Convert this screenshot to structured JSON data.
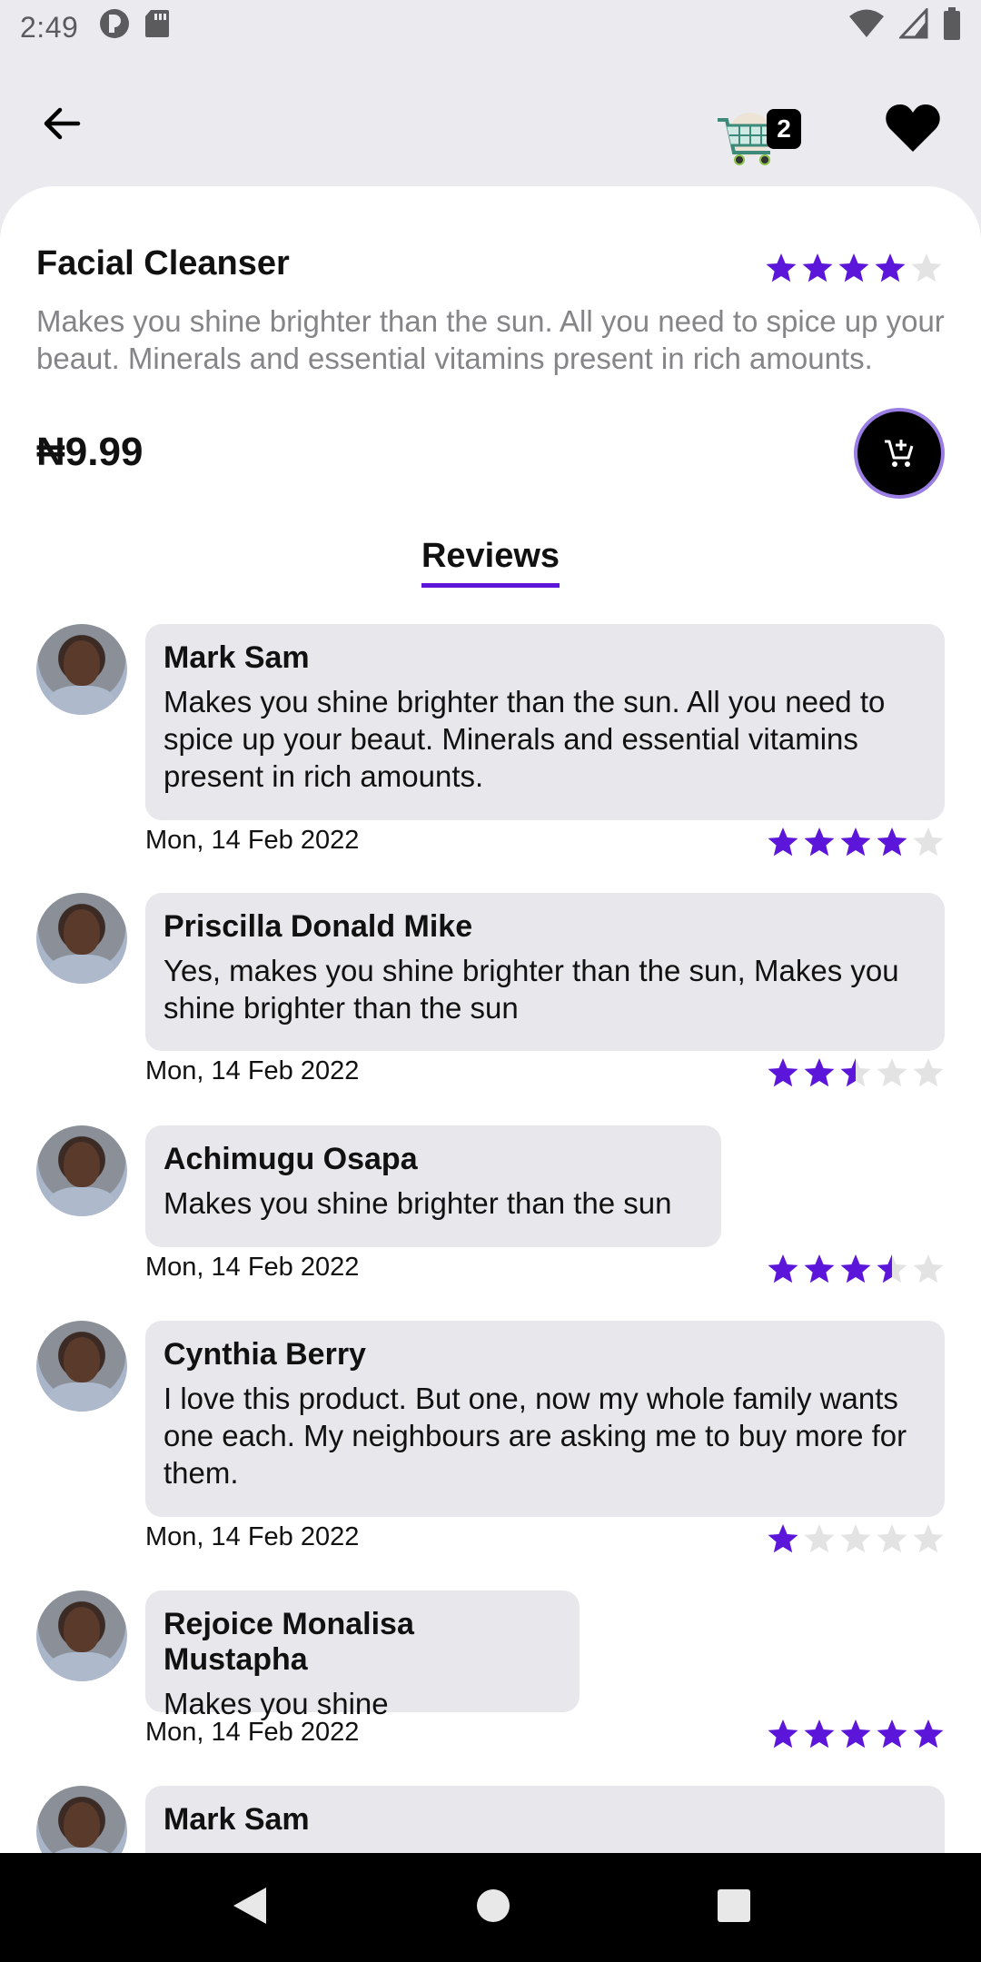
{
  "status": {
    "time": "2:49"
  },
  "header": {
    "cart_count": "2"
  },
  "product": {
    "name": "Facial Cleanser",
    "rating": 4,
    "description": "Makes you shine brighter than the sun. All you need to spice up your beaut. Minerals and essential vitamins present in rich amounts.",
    "price": "₦9.99"
  },
  "reviews_tab": {
    "label": "Reviews"
  },
  "reviews": [
    {
      "name": "Mark Sam",
      "text": "Makes you shine brighter than the sun. All you need to spice up your beaut. Minerals and essential vitamins present in rich amounts.",
      "date": "Mon, 14 Feb 2022",
      "rating": 4
    },
    {
      "name": "Priscilla Donald Mike",
      "text": "Yes, makes you shine brighter than the sun, Makes you shine brighter than the sun",
      "date": "Mon, 14 Feb 2022",
      "rating": 2.5
    },
    {
      "name": "Achimugu Osapa",
      "text": "Makes you shine brighter than the sun",
      "date": "Mon, 14 Feb 2022",
      "rating": 3.5
    },
    {
      "name": "Cynthia Berry",
      "text": "I love this product. But one, now my whole family wants one each. My neighbours are asking me to buy more for them.",
      "date": "Mon, 14 Feb 2022",
      "rating": 1
    },
    {
      "name": "Rejoice Monalisa Mustapha",
      "text": "Makes you shine",
      "date": "Mon, 14 Feb 2022",
      "rating": 5
    },
    {
      "name": "Mark Sam",
      "text": "",
      "date": "",
      "rating": 0
    }
  ],
  "colors": {
    "accent": "#5b16d9",
    "star_empty": "#e3e3e3",
    "bubble": "#e8e7eb",
    "background": "#ebeaee"
  }
}
